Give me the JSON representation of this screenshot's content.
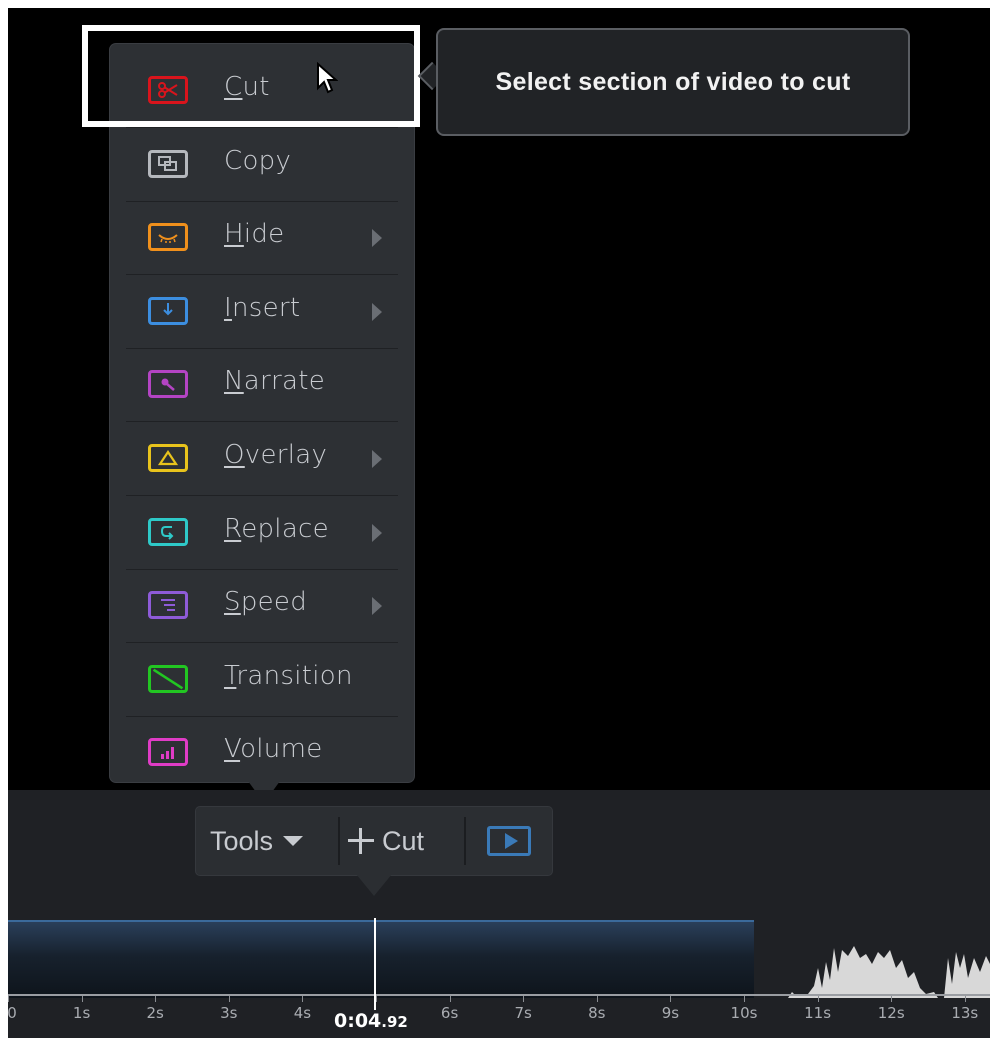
{
  "menu": {
    "items": [
      {
        "name": "cut",
        "label": "Cut",
        "underline": "C",
        "rest": "ut",
        "color": "#d9141c",
        "icon": "scissors-icon",
        "submenu": false
      },
      {
        "name": "copy",
        "label": "Copy",
        "underline": "",
        "rest": "Copy",
        "color": "#b5b8bd",
        "icon": "copy-icon",
        "submenu": false
      },
      {
        "name": "hide",
        "label": "Hide",
        "underline": "H",
        "rest": "ide",
        "color": "#f0901c",
        "icon": "eye-closed-icon",
        "submenu": true
      },
      {
        "name": "insert",
        "label": "Insert",
        "underline": "I",
        "rest": "nsert",
        "color": "#3c8ee0",
        "icon": "insert-icon",
        "submenu": true
      },
      {
        "name": "narrate",
        "label": "Narrate",
        "underline": "N",
        "rest": "arrate",
        "color": "#b444c4",
        "icon": "microphone-icon",
        "submenu": false
      },
      {
        "name": "overlay",
        "label": "Overlay",
        "underline": "O",
        "rest": "verlay",
        "color": "#e8c31c",
        "icon": "triangle-icon",
        "submenu": true
      },
      {
        "name": "replace",
        "label": "Replace",
        "underline": "R",
        "rest": "eplace",
        "color": "#2ec9c8",
        "icon": "replace-icon",
        "submenu": true
      },
      {
        "name": "speed",
        "label": "Speed",
        "underline": "S",
        "rest": "peed",
        "color": "#8e5bd8",
        "icon": "speed-icon",
        "submenu": true
      },
      {
        "name": "transition",
        "label": "Transition",
        "underline": "T",
        "rest": "ransition",
        "color": "#22c622",
        "icon": "transition-icon",
        "submenu": false
      },
      {
        "name": "volume",
        "label": "Volume",
        "underline": "V",
        "rest": "olume",
        "color": "#e03cc6",
        "icon": "volume-bars-icon",
        "submenu": false
      }
    ]
  },
  "tooltip": {
    "text": "Select section of video to cut"
  },
  "toolbar": {
    "tools_label": "Tools",
    "cut_label": "Cut",
    "preview_icon": "play-preview-icon"
  },
  "timeline": {
    "ticks": [
      "0",
      "1s",
      "2s",
      "3s",
      "4s",
      "5s",
      "6s",
      "7s",
      "8s",
      "9s",
      "10s",
      "11s",
      "12s",
      "13s"
    ],
    "current_time_main": "0:04",
    "current_time_fraction": ".92",
    "playhead_seconds": 4.92,
    "clip_end_seconds": 10
  }
}
